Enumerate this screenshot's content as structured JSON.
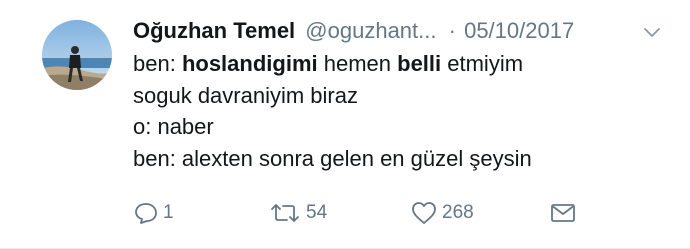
{
  "tweet": {
    "user": {
      "fullname": "Oğuzhan Temel",
      "username": "@oguzhant...",
      "avatar": "profile-photo"
    },
    "separator": "·",
    "date": "05/10/2017",
    "lines": [
      {
        "parts": [
          {
            "text": "ben: "
          },
          {
            "text": "hoslandigimi",
            "bold": true
          },
          {
            "text": " hemen "
          },
          {
            "text": "belli",
            "bold": true
          },
          {
            "text": " etmiyim"
          }
        ]
      },
      {
        "parts": [
          {
            "text": "soguk davraniyim biraz"
          }
        ]
      },
      {
        "parts": [
          {
            "text": "o: naber"
          }
        ]
      },
      {
        "parts": [
          {
            "text": "ben: alexten sonra gelen en güzel şeysin"
          }
        ]
      }
    ],
    "actions": {
      "reply": {
        "icon": "reply-icon",
        "count": "1"
      },
      "retweet": {
        "icon": "retweet-icon",
        "count": "54"
      },
      "like": {
        "icon": "heart-icon",
        "count": "268"
      },
      "message": {
        "icon": "envelope-icon"
      }
    }
  },
  "colors": {
    "text": "#14171a",
    "secondary": "#657786",
    "border": "#e6ecf0"
  }
}
